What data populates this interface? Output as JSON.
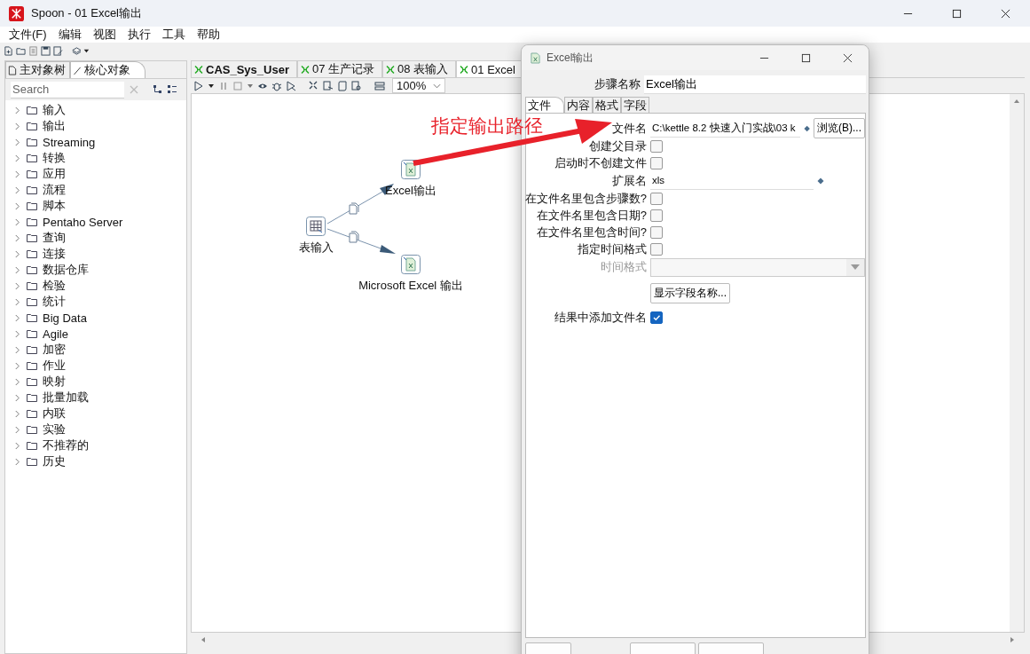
{
  "window": {
    "title": "Spoon - 01 Excel输出"
  },
  "menu": [
    "文件(F)",
    "编辑",
    "视图",
    "执行",
    "工具",
    "帮助"
  ],
  "side_tabs": [
    {
      "label": "主对象树",
      "selected": false
    },
    {
      "label": "核心对象",
      "selected": true
    }
  ],
  "search": {
    "placeholder": "Search"
  },
  "tree": [
    {
      "label": "输入",
      "expanded": false
    },
    {
      "label": "输出",
      "expanded": false
    },
    {
      "label": "Streaming",
      "expanded": false
    },
    {
      "label": "转换",
      "expanded": false
    },
    {
      "label": "应用",
      "expanded": false
    },
    {
      "label": "流程",
      "expanded": false
    },
    {
      "label": "脚本",
      "expanded": false
    },
    {
      "label": "Pentaho Server",
      "expanded": false
    },
    {
      "label": "查询",
      "expanded": false
    },
    {
      "label": "连接",
      "expanded": false
    },
    {
      "label": "数据仓库",
      "expanded": false
    },
    {
      "label": "检验",
      "expanded": false
    },
    {
      "label": "统计",
      "expanded": false
    },
    {
      "label": "Big Data",
      "expanded": false
    },
    {
      "label": "Agile",
      "expanded": false
    },
    {
      "label": "加密",
      "expanded": false
    },
    {
      "label": "作业",
      "expanded": false
    },
    {
      "label": "映射",
      "expanded": false
    },
    {
      "label": "批量加载",
      "expanded": false
    },
    {
      "label": "内联",
      "expanded": false
    },
    {
      "label": "实验",
      "expanded": false
    },
    {
      "label": "不推荐的",
      "expanded": false
    },
    {
      "label": "历史",
      "expanded": false
    }
  ],
  "doc_tabs": [
    {
      "label": "CAS_Sys_User",
      "selected": false,
      "unsaved": true
    },
    {
      "label": "07 生产记录",
      "selected": false,
      "unsaved": false
    },
    {
      "label": "08 表输入",
      "selected": false,
      "unsaved": false
    },
    {
      "label": "01 Excel",
      "selected": true,
      "unsaved": false
    }
  ],
  "zoom": "100%",
  "steps": [
    {
      "label": "表输入",
      "kind": "table"
    },
    {
      "label": "Excel输出",
      "kind": "excel"
    },
    {
      "label": "Microsoft Excel 输出",
      "kind": "excel"
    }
  ],
  "annotation": "指定输出路径",
  "dialog": {
    "title": "Excel输出",
    "step_name_label": "步骤名称",
    "step_name": "Excel输出",
    "tabs": [
      {
        "label": "文件",
        "selected": true
      },
      {
        "label": "内容",
        "selected": false
      },
      {
        "label": "格式",
        "selected": false
      },
      {
        "label": "字段",
        "selected": false
      }
    ],
    "rows": [
      {
        "kind": "text",
        "label": "文件名",
        "value": "C:\\kettle 8.2 快速入门实战\\03 k",
        "button": "浏览(B)..."
      },
      {
        "kind": "checkbox",
        "label": "创建父目录",
        "checked": false
      },
      {
        "kind": "checkbox",
        "label": "启动时不创建文件",
        "checked": false
      },
      {
        "kind": "text",
        "label": "扩展名",
        "value": "xls"
      },
      {
        "kind": "checkbox",
        "label": "在文件名里包含步骤数?",
        "checked": false
      },
      {
        "kind": "checkbox",
        "label": "在文件名里包含日期?",
        "checked": false
      },
      {
        "kind": "checkbox",
        "label": "在文件名里包含时间?",
        "checked": false
      },
      {
        "kind": "checkbox",
        "label": "指定时间格式",
        "checked": false
      },
      {
        "kind": "combo",
        "label": "时间格式",
        "disabled": true
      },
      {
        "kind": "button",
        "button": "显示字段名称..."
      },
      {
        "kind": "checkbox",
        "label": "结果中添加文件名",
        "checked": true
      }
    ]
  }
}
